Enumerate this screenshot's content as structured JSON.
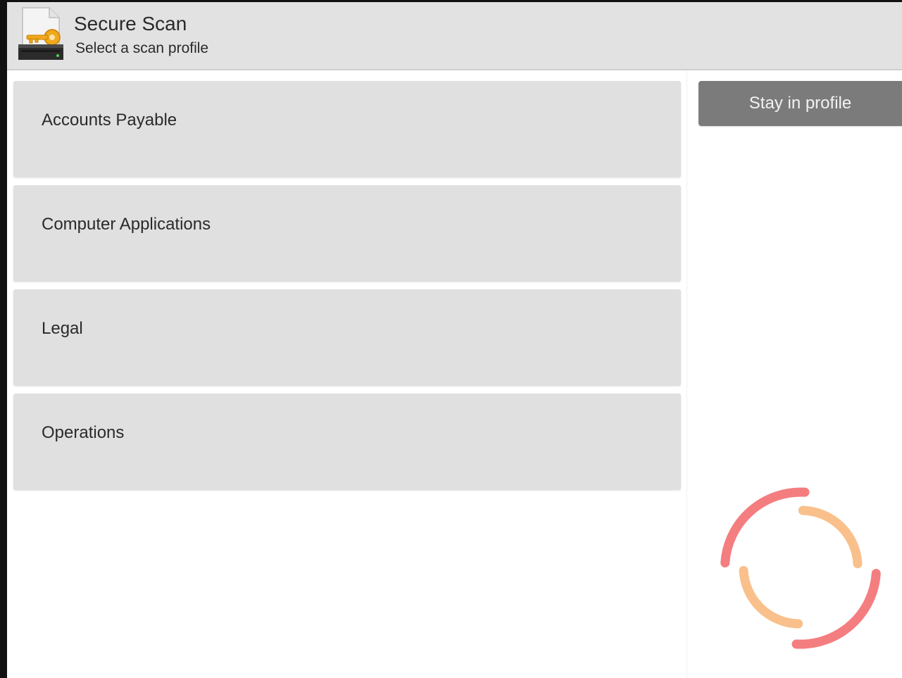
{
  "header": {
    "title": "Secure Scan",
    "subtitle": "Select a scan profile",
    "icon": "secure-scan-app-icon"
  },
  "profiles": [
    {
      "label": "Accounts Payable"
    },
    {
      "label": "Computer Applications"
    },
    {
      "label": "Legal"
    },
    {
      "label": "Operations"
    }
  ],
  "actions": {
    "stay_label": "Stay in profile"
  },
  "spinner": {
    "icon": "loading-spinner-icon",
    "outer_color": "#f47d7f",
    "inner_color": "#f9c08c"
  },
  "colors": {
    "header_bg": "#e2e2e2",
    "tile_bg": "#e0e0e0",
    "button_bg": "#7b7b7b",
    "key_color": "#f0a81c"
  }
}
